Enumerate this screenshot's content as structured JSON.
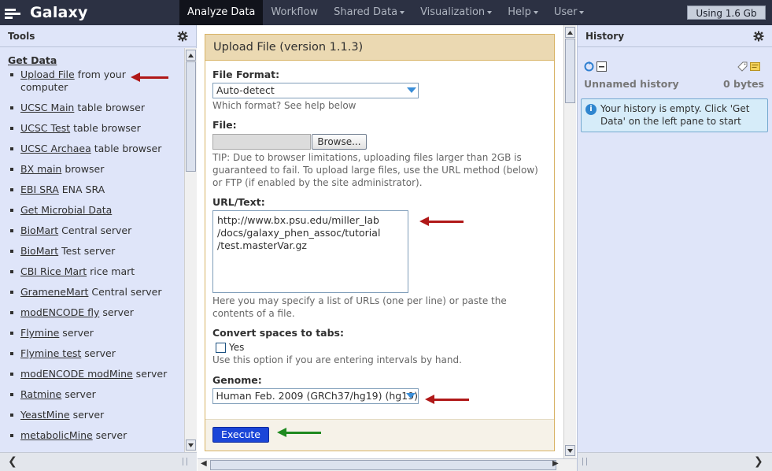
{
  "brand": {
    "title": "Galaxy"
  },
  "nav": {
    "tabs": [
      {
        "label": "Analyze Data",
        "active": true,
        "dropdown": false
      },
      {
        "label": "Workflow",
        "active": false,
        "dropdown": false
      },
      {
        "label": "Shared Data",
        "active": false,
        "dropdown": true
      },
      {
        "label": "Visualization",
        "active": false,
        "dropdown": true
      },
      {
        "label": "Help",
        "active": false,
        "dropdown": true
      },
      {
        "label": "User",
        "active": false,
        "dropdown": true
      }
    ],
    "quota": "Using 1.6 Gb"
  },
  "tools_panel": {
    "title": "Tools",
    "section": "Get Data",
    "items": [
      {
        "link": "Upload File",
        "rest": " from your computer"
      },
      {
        "link": "UCSC Main",
        "rest": " table browser"
      },
      {
        "link": "UCSC Test",
        "rest": " table browser"
      },
      {
        "link": "UCSC Archaea",
        "rest": " table browser"
      },
      {
        "link": "BX main",
        "rest": " browser"
      },
      {
        "link": "EBI SRA",
        "rest": " ENA SRA"
      },
      {
        "link": "Get Microbial Data",
        "rest": ""
      },
      {
        "link": "BioMart",
        "rest": " Central server"
      },
      {
        "link": "BioMart",
        "rest": " Test server"
      },
      {
        "link": "CBI Rice Mart",
        "rest": " rice mart"
      },
      {
        "link": "GrameneMart",
        "rest": " Central server"
      },
      {
        "link": "modENCODE fly",
        "rest": " server"
      },
      {
        "link": "Flymine",
        "rest": " server"
      },
      {
        "link": "Flymine test",
        "rest": " server"
      },
      {
        "link": "modENCODE modMine",
        "rest": " server"
      },
      {
        "link": "Ratmine",
        "rest": " server"
      },
      {
        "link": "YeastMine",
        "rest": " server"
      },
      {
        "link": "metabolicMine",
        "rest": " server"
      }
    ]
  },
  "form": {
    "title": "Upload File (version 1.1.3)",
    "file_format": {
      "label": "File Format:",
      "value": "Auto-detect",
      "help": "Which format? See help below"
    },
    "file": {
      "label": "File:",
      "browse_label": "Browse...",
      "help": "TIP: Due to browser limitations, uploading files larger than 2GB is guaranteed to fail. To upload large files, use the URL method (below) or FTP (if enabled by the site administrator)."
    },
    "url_text": {
      "label": "URL/Text:",
      "value": "http://www.bx.psu.edu/miller_lab\n/docs/galaxy_phen_assoc/tutorial\n/test.masterVar.gz",
      "help": "Here you may specify a list of URLs (one per line) or paste the contents of a file."
    },
    "convert_spaces": {
      "label": "Convert spaces to tabs:",
      "option": "Yes",
      "help": "Use this option if you are entering intervals by hand."
    },
    "genome": {
      "label": "Genome:",
      "value": "Human Feb. 2009 (GRCh37/hg19) (hg19)"
    },
    "execute_label": "Execute"
  },
  "history_panel": {
    "title": "History",
    "name": "Unnamed history",
    "size": "0 bytes",
    "message": "Your history is empty. Click 'Get Data' on the left pane to start"
  },
  "colors": {
    "masthead": "#2c3143",
    "panel_bg": "#dfe5f9",
    "form_header": "#ebd9b2",
    "execute": "#1b46d8",
    "arrow_red": "#b01818",
    "arrow_green": "#1f8a1f"
  }
}
